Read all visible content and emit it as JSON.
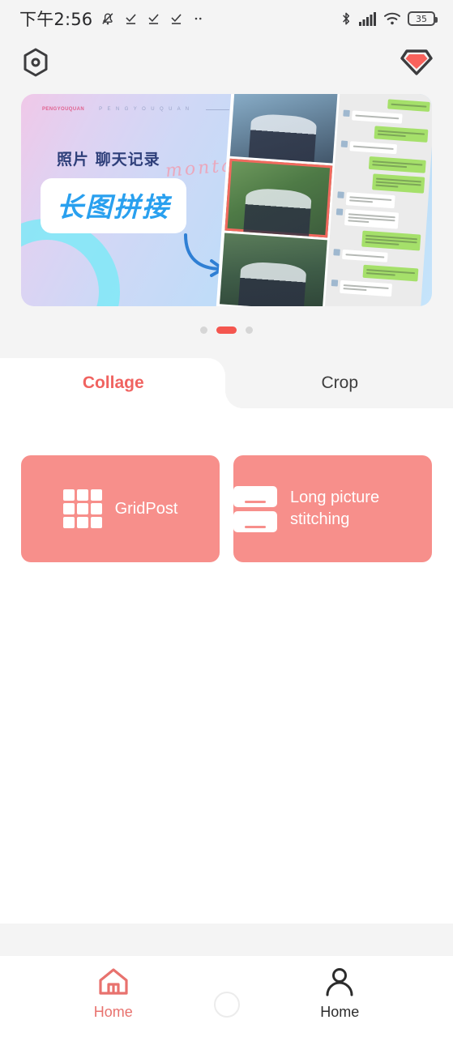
{
  "status_bar": {
    "time": "下午2:56",
    "battery_level": "35",
    "icons": [
      "bell-muted-icon",
      "check-underline-icon",
      "check-underline-icon",
      "check-underline-icon",
      "more-dots-icon",
      "bluetooth-icon",
      "cellular-signal-icon",
      "wifi-icon",
      "battery-icon"
    ]
  },
  "top_bar": {
    "left_icon": "hexagon-settings-icon",
    "right_icon": "diamond-premium-icon"
  },
  "banner": {
    "brand": "PENGYOUQUAN",
    "brand_spaced": "P E N G Y O U Q U A N",
    "subtitle": "照片 聊天记录",
    "script_text": "montage",
    "headline": "长图拼接",
    "arrow_icon": "curved-arrow-icon"
  },
  "carousel": {
    "dots": [
      {
        "active": false
      },
      {
        "active": true
      },
      {
        "active": false
      }
    ]
  },
  "tabs": [
    {
      "label": "Collage",
      "active": true
    },
    {
      "label": "Crop",
      "active": false
    }
  ],
  "feature_cards": [
    {
      "label": "GridPost",
      "icon": "grid-3x3-icon"
    },
    {
      "label": "Long picture stitching",
      "icon": "stacked-panels-icon"
    }
  ],
  "bottom_nav": [
    {
      "label": "Home",
      "icon": "home-icon",
      "active": true
    },
    {
      "label": "Home",
      "icon": "user-profile-icon",
      "active": false
    }
  ],
  "colors": {
    "accent": "#f06360",
    "card": "#f78f8b",
    "page_bg": "#f4f4f4",
    "banner_blue": "#29a0ef"
  }
}
